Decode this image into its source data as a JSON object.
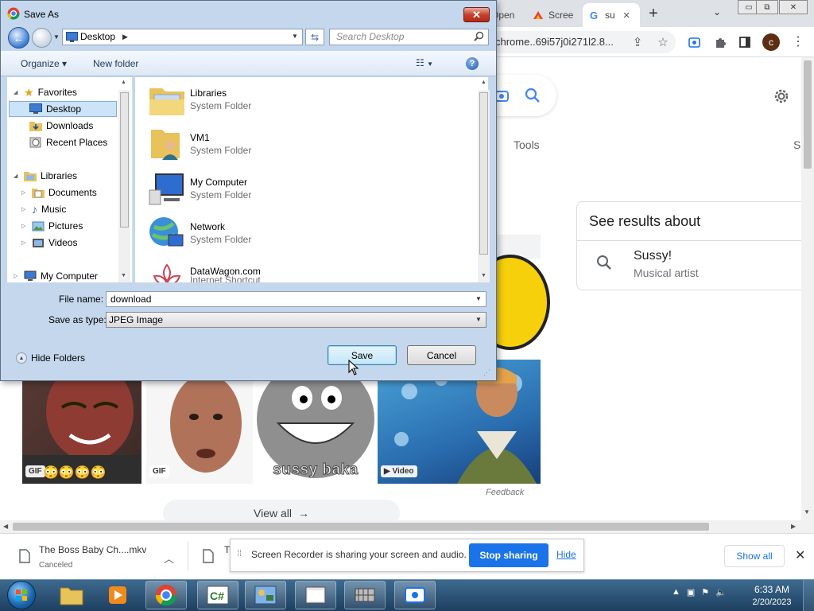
{
  "browser": {
    "tabs": [
      {
        "label": "Open"
      },
      {
        "label": "Scree"
      },
      {
        "label": "su",
        "active": true
      }
    ],
    "new_tab": "+",
    "tab_close": "×",
    "window_controls": [
      "▭",
      "⧉",
      "✕"
    ],
    "url": "chrome..69i57j0i271l2.8...",
    "profile_initial": "c"
  },
  "google": {
    "tools_label": "Tools",
    "settings_partial": "S",
    "knowledge_panel": {
      "title": "See results about",
      "entity_name": "Sussy!",
      "entity_subtitle": "Musical artist"
    },
    "images": [
      {
        "badge": "GIF",
        "emoji": "😳😳😳😳"
      },
      {
        "badge": "GIF"
      },
      {
        "caption": "sussy baka"
      },
      {
        "badge": "▶ Video"
      }
    ],
    "feedback": "Feedback",
    "view_all": "View all",
    "view_all_arrow": "→"
  },
  "downloads": {
    "items": [
      {
        "name": "The Boss Baby Ch....mkv",
        "status": "Canceled"
      },
      {
        "name": "T"
      }
    ],
    "show_all": "Show all",
    "close": "✕"
  },
  "screen_recorder": {
    "message": "Screen Recorder is sharing your screen and audio.",
    "stop_label": "Stop sharing",
    "hide_label": "Hide"
  },
  "dialog": {
    "title": "Save As",
    "close": "✕",
    "address": "Desktop",
    "search_placeholder": "Search Desktop",
    "organize": "Organize ▾",
    "new_folder": "New folder",
    "help": "?",
    "nav": [
      {
        "label": "Favorites",
        "icon": "star-icon"
      },
      {
        "label": "Desktop",
        "icon": "desktop-icon",
        "selected": true
      },
      {
        "label": "Downloads",
        "icon": "downloads-folder-icon"
      },
      {
        "label": "Recent Places",
        "icon": "recent-places-icon"
      },
      {
        "label": "Libraries",
        "icon": "libraries-icon"
      },
      {
        "label": "Documents",
        "icon": "documents-icon"
      },
      {
        "label": "Music",
        "icon": "music-icon"
      },
      {
        "label": "Pictures",
        "icon": "pictures-icon"
      },
      {
        "label": "Videos",
        "icon": "videos-icon"
      },
      {
        "label": "My Computer",
        "icon": "computer-icon"
      }
    ],
    "files": [
      {
        "name": "Libraries",
        "type": "System Folder",
        "icon": "libraries-folder-icon"
      },
      {
        "name": "VM1",
        "type": "System Folder",
        "icon": "user-folder-icon"
      },
      {
        "name": "My Computer",
        "type": "System Folder",
        "icon": "computer-icon"
      },
      {
        "name": "Network",
        "type": "System Folder",
        "icon": "network-icon"
      },
      {
        "name": "DataWagon.com",
        "type": "Internet Shortcut",
        "icon": "shortcut-icon"
      }
    ],
    "file_name_label": "File name:",
    "file_name_value": "download",
    "save_type_label": "Save as type:",
    "save_type_value": "JPEG Image",
    "hide_folders": "Hide Folders",
    "save_button": "Save",
    "cancel_button": "Cancel"
  },
  "taskbar": {
    "time": "6:33 AM",
    "date": "2/20/2023"
  },
  "colors": {
    "accent_blue": "#1a73e8",
    "dialog_frame": "#c4d7ec",
    "taskbar": "#1d3f60"
  }
}
